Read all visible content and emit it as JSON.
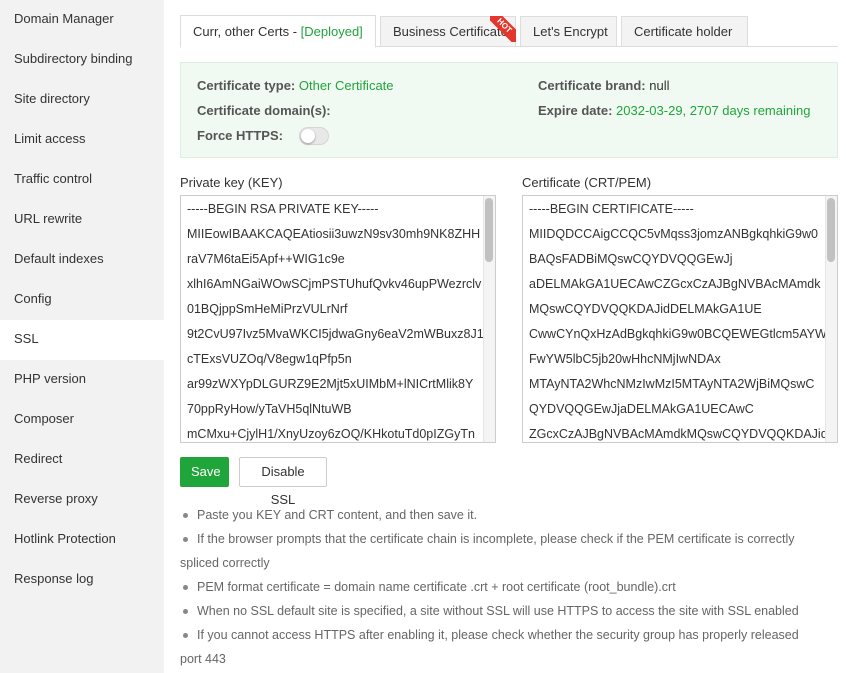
{
  "sidebar": {
    "items": [
      {
        "label": "Domain Manager"
      },
      {
        "label": "Subdirectory binding"
      },
      {
        "label": "Site directory"
      },
      {
        "label": "Limit access"
      },
      {
        "label": "Traffic control"
      },
      {
        "label": "URL rewrite"
      },
      {
        "label": "Default indexes"
      },
      {
        "label": "Config"
      },
      {
        "label": "SSL"
      },
      {
        "label": "PHP version"
      },
      {
        "label": "Composer"
      },
      {
        "label": "Redirect"
      },
      {
        "label": "Reverse proxy"
      },
      {
        "label": "Hotlink Protection"
      },
      {
        "label": "Response log"
      }
    ],
    "active": "SSL"
  },
  "tabs": {
    "current": {
      "label": "Curr, other Certs - ",
      "status": "[Deployed]"
    },
    "business": {
      "label": "Business Certificate",
      "badge": "HOT"
    },
    "letsencrypt": {
      "label": "Let's Encrypt"
    },
    "holder": {
      "label": "Certificate holder"
    }
  },
  "info": {
    "type_label": "Certificate type:",
    "type_value": "Other Certificate",
    "brand_label": "Certificate brand:",
    "brand_value": "null",
    "domains_label": "Certificate domain(s):",
    "domains_value": "",
    "expire_label": "Expire date:",
    "expire_value": "2032-03-29, 2707 days remaining",
    "force_https_label": "Force HTTPS:",
    "force_https_on": false
  },
  "key": {
    "label": "Private key (KEY)",
    "lines": [
      "-----BEGIN RSA PRIVATE KEY-----",
      "MIIEowIBAAKCAQEAtiosii3uwzN9sv30mh9NK8ZHH",
      "raV7M6taEi5Apf++WIG1c9e",
      "xlhI6AmNGaiWOwSCjmPSTUhufQvkv46upPWezrclv",
      "01BQjppSmHeMiPrzVULrNrf",
      "9t2CvU97Ivz5MvaWKCI5jdwaGny6eaV2mWBuxz8J1",
      "cTExsVUZOq/V8egw1qPfp5n",
      "ar99zWXYpDLGURZ9E2Mjt5xUIMbM+lNICrtMlik8Y",
      "70ppRyHow/yTaVH5qlNtuWB",
      "mCMxu+CjylH1/XnyUzoy6zOQ/KHkotuTd0pIZGyTn"
    ]
  },
  "cert": {
    "label": "Certificate (CRT/PEM)",
    "lines": [
      "-----BEGIN CERTIFICATE-----",
      "MIIDQDCCAigCCQC5vMqss3jomzANBgkqhkiG9w0",
      "BAQsFADBiMQswCQYDVQQGEwJj",
      "aDELMAkGA1UECAwCZGcxCzAJBgNVBAcMAmdk",
      "MQswCQYDVQQKDAJidDELMAkGA1UE",
      "CwwCYnQxHzAdBgkqhkiG9w0BCQEWEGtlcm5AYW",
      "FwYW5lbC5jb20wHhcNMjIwNDAx",
      "MTAyNTA2WhcNMzIwMzI5MTAyNTA2WjBiMQswC",
      "QYDVQQGEwJjaDELMAkGA1UECAwC",
      "ZGcxCzAJBgNVBAcMAmdkMQswCQYDVQQKDAJid"
    ]
  },
  "buttons": {
    "save": "Save",
    "disable": "Disable SSL"
  },
  "tips": [
    {
      "text": "Paste you KEY and CRT content, and then save it.",
      "cont": ""
    },
    {
      "text": "If the browser prompts that the certificate chain is incomplete, please check if the PEM certificate is correctly",
      "cont": "spliced correctly"
    },
    {
      "text": "PEM format certificate = domain name certificate .crt + root certificate (root_bundle).crt",
      "cont": ""
    },
    {
      "text": "When no SSL default site is specified, a site without SSL will use HTTPS to access the site with SSL enabled",
      "cont": ""
    },
    {
      "text": "If you cannot access HTTPS after enabling it, please check whether the security group has properly released",
      "cont": "port 443"
    }
  ],
  "colors": {
    "accent": "#20a53a",
    "info_bg": "#f1f9f3",
    "hot_badge": "#e3362c",
    "sidebar_bg": "#f2f2f2"
  }
}
